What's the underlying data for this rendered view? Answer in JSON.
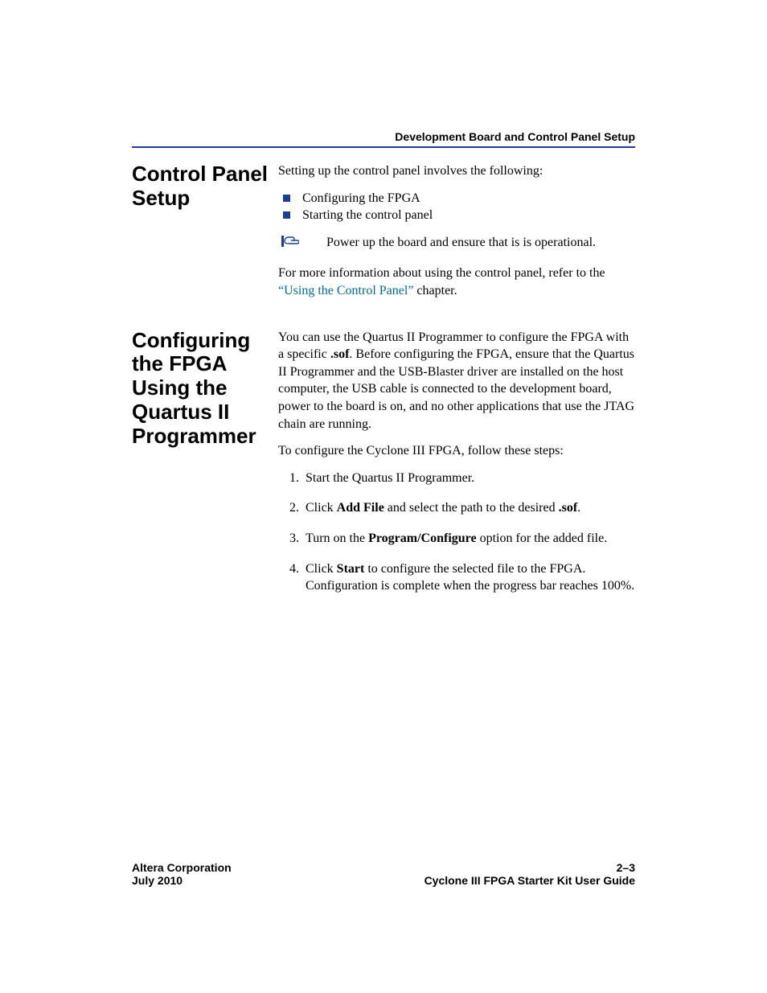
{
  "running_head": "Development Board and Control Panel Setup",
  "section1": {
    "heading": "Control Panel Setup",
    "intro": "Setting up the control panel involves the following:",
    "bullets": [
      "Configuring the FPGA",
      "Starting the control panel"
    ],
    "note": "Power up the board and ensure that is is operational.",
    "ref_pre": "For more information about using the control panel, refer to the ",
    "ref_link": "“Using the Control Panel”",
    "ref_post": " chapter."
  },
  "section2": {
    "heading": "Configuring the FPGA Using the Quartus II Programmer",
    "para1_a": "You can use the Quartus II Programmer to configure the FPGA with a specific ",
    "para1_b": ".sof",
    "para1_c": ". Before configuring the FPGA, ensure that the Quartus II Programmer and the USB-Blaster driver are installed on the host computer, the USB cable is connected to the development board, power to the board is on, and no other applications that use the JTAG chain are running.",
    "para2": "To configure the Cyclone III FPGA, follow these steps:",
    "steps": {
      "s1": "Start the Quartus II Programmer.",
      "s2_a": "Click ",
      "s2_b": "Add File",
      "s2_c": " and select the path to the desired ",
      "s2_d": ".sof",
      "s2_e": ".",
      "s3_a": "Turn on the ",
      "s3_b": "Program/Configure",
      "s3_c": " option for the added file.",
      "s4_a": "Click ",
      "s4_b": "Start",
      "s4_c": " to configure the selected file to the FPGA. Configuration is complete when the progress bar reaches 100%."
    }
  },
  "footer": {
    "left1": "Altera Corporation",
    "left2": "July 2010",
    "right1": "2–3",
    "right2": "Cyclone III FPGA Starter Kit User Guide"
  }
}
